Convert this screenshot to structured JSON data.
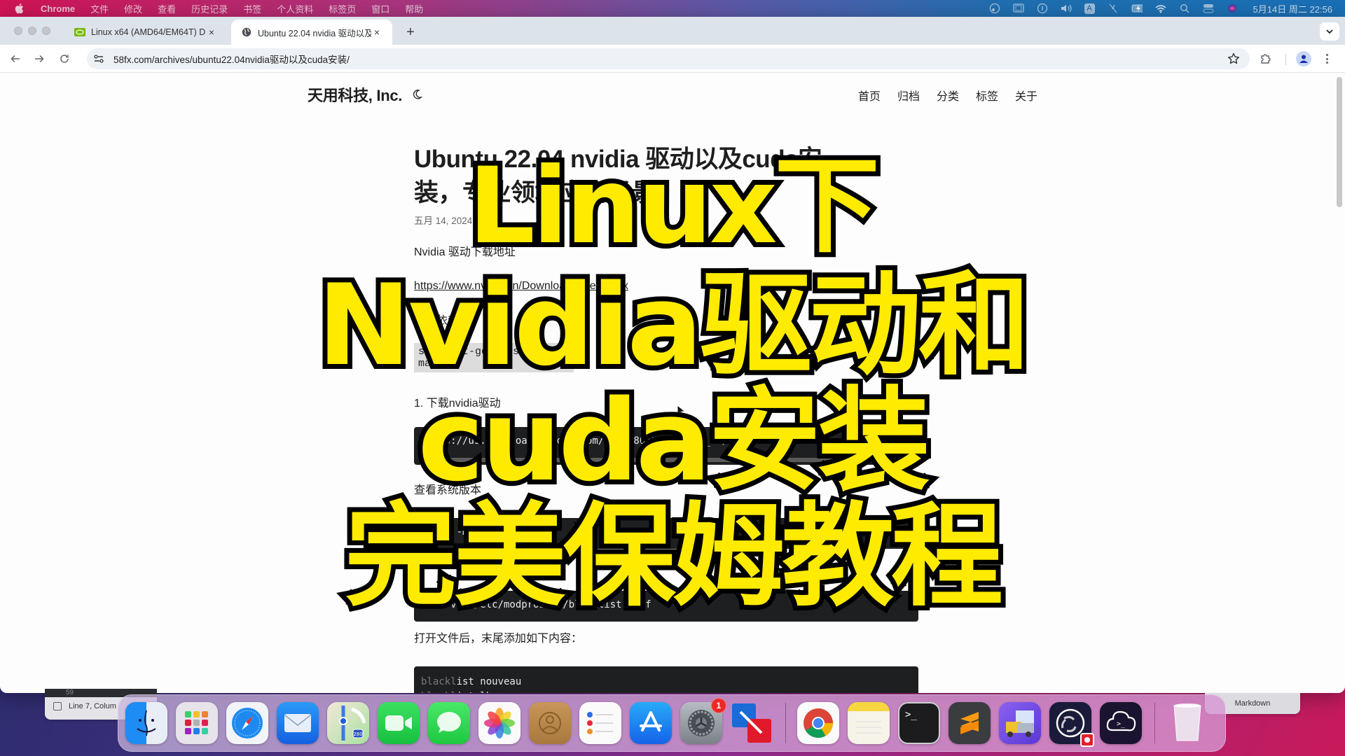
{
  "menubar": {
    "app_name": "Chrome",
    "items": [
      "文件",
      "修改",
      "查看",
      "历史记录",
      "书签",
      "个人资料",
      "标签页",
      "窗口",
      "帮助"
    ],
    "status_icons": [
      "screen-share-icon",
      "display-icon",
      "accessibility-icon",
      "volume-icon",
      "input-source-icon",
      "mic-off-icon",
      "battery-charging-icon",
      "wifi-icon",
      "spotlight-search-icon",
      "control-center-icon",
      "siri-icon"
    ],
    "input_source_label": "A",
    "clock": "5月14日 周二 22:56"
  },
  "browser": {
    "tabs": [
      {
        "title": "Linux x64 (AMD64/EM64T) D",
        "favicon": "nvidia-favicon-icon",
        "active": false
      },
      {
        "title": "Ubuntu 22.04 nvidia 驱动以及",
        "favicon": "globe-icon",
        "active": true
      }
    ],
    "new_tab_label": "+",
    "close_label": "×",
    "url": "58fx.com/archives/ubuntu22.04nvidia驱动以及cuda安装/"
  },
  "site": {
    "title": "天用科技, Inc.",
    "nav": [
      "首页",
      "归档",
      "分类",
      "标签",
      "关于"
    ]
  },
  "article": {
    "title": "Ubuntu 22.04 nvidia 驱动以及cuda安装，专业领域使用场景",
    "title_visible_line1": "Ubuntu 22.04 nvidia 驱动以及cuda安",
    "title_visible_line2": "装，专业领域应用场景",
    "meta": "五月 14, 2024",
    "para_driver_link_heading": "Nvidia 驱动下载地址",
    "driver_link": "https://www.nvidia.cn/Download/index.aspx",
    "para_install_deps": "安装依赖",
    "inline_cmd": "sudo apt-get install make",
    "step1": "1. 下载nvidia驱动",
    "code1": "https://us.download.nvidia.com/XFree86/Linux-x86_64/",
    "para_check": "查看系统版本",
    "code2": "uname -m   x86_64",
    "code3": "sudo vim /etc/modprobe.d/blacklist.conf",
    "para_append": "打开文件后，末尾添加如下内容：",
    "code4_lines": [
      {
        "kw": "blackl",
        "rest": "ist nouveau"
      },
      {
        "kw": "blackl",
        "rest": "ist lbm-nouveau"
      }
    ]
  },
  "overlay": {
    "lines": [
      "Linux下",
      "Nvidia驱动和",
      "cuda安装",
      "完美保姆教程"
    ],
    "fill_color": "#ffeb00",
    "stroke_color": "#000000"
  },
  "background_windows": {
    "editor_line_number": "59",
    "editor_status": "Line 7, Colum",
    "right_status": "Markdown"
  },
  "dock": {
    "apps": [
      {
        "name": "Finder",
        "icon": "finder-icon"
      },
      {
        "name": "Launchpad",
        "icon": "launchpad-icon"
      },
      {
        "name": "Safari",
        "icon": "safari-icon"
      },
      {
        "name": "Mail",
        "icon": "mail-icon"
      },
      {
        "name": "Maps",
        "icon": "maps-icon",
        "label": "280"
      },
      {
        "name": "FaceTime",
        "icon": "facetime-icon"
      },
      {
        "name": "Messages",
        "icon": "messages-icon"
      },
      {
        "name": "Photos",
        "icon": "photos-icon"
      },
      {
        "name": "Contacts",
        "icon": "contacts-icon"
      },
      {
        "name": "Reminders",
        "icon": "reminders-icon"
      },
      {
        "name": "App Store",
        "icon": "app-store-icon"
      },
      {
        "name": "System Settings",
        "icon": "system-settings-icon",
        "badge": "1"
      },
      {
        "name": "VMware Fusion",
        "icon": "vmware-fusion-icon"
      },
      {
        "name": "Google Chrome",
        "icon": "chrome-icon"
      },
      {
        "name": "Notes",
        "icon": "notes-icon"
      },
      {
        "name": "Terminal",
        "icon": "terminal-icon",
        "label": ">_"
      },
      {
        "name": "Sublime Text",
        "icon": "sublime-text-icon"
      },
      {
        "name": "Transmit",
        "icon": "transmit-icon"
      },
      {
        "name": "OBS",
        "icon": "obs-icon"
      },
      {
        "name": "Termius",
        "icon": "termius-icon",
        "label": ">_"
      },
      {
        "name": "Trash",
        "icon": "trash-icon"
      }
    ]
  }
}
